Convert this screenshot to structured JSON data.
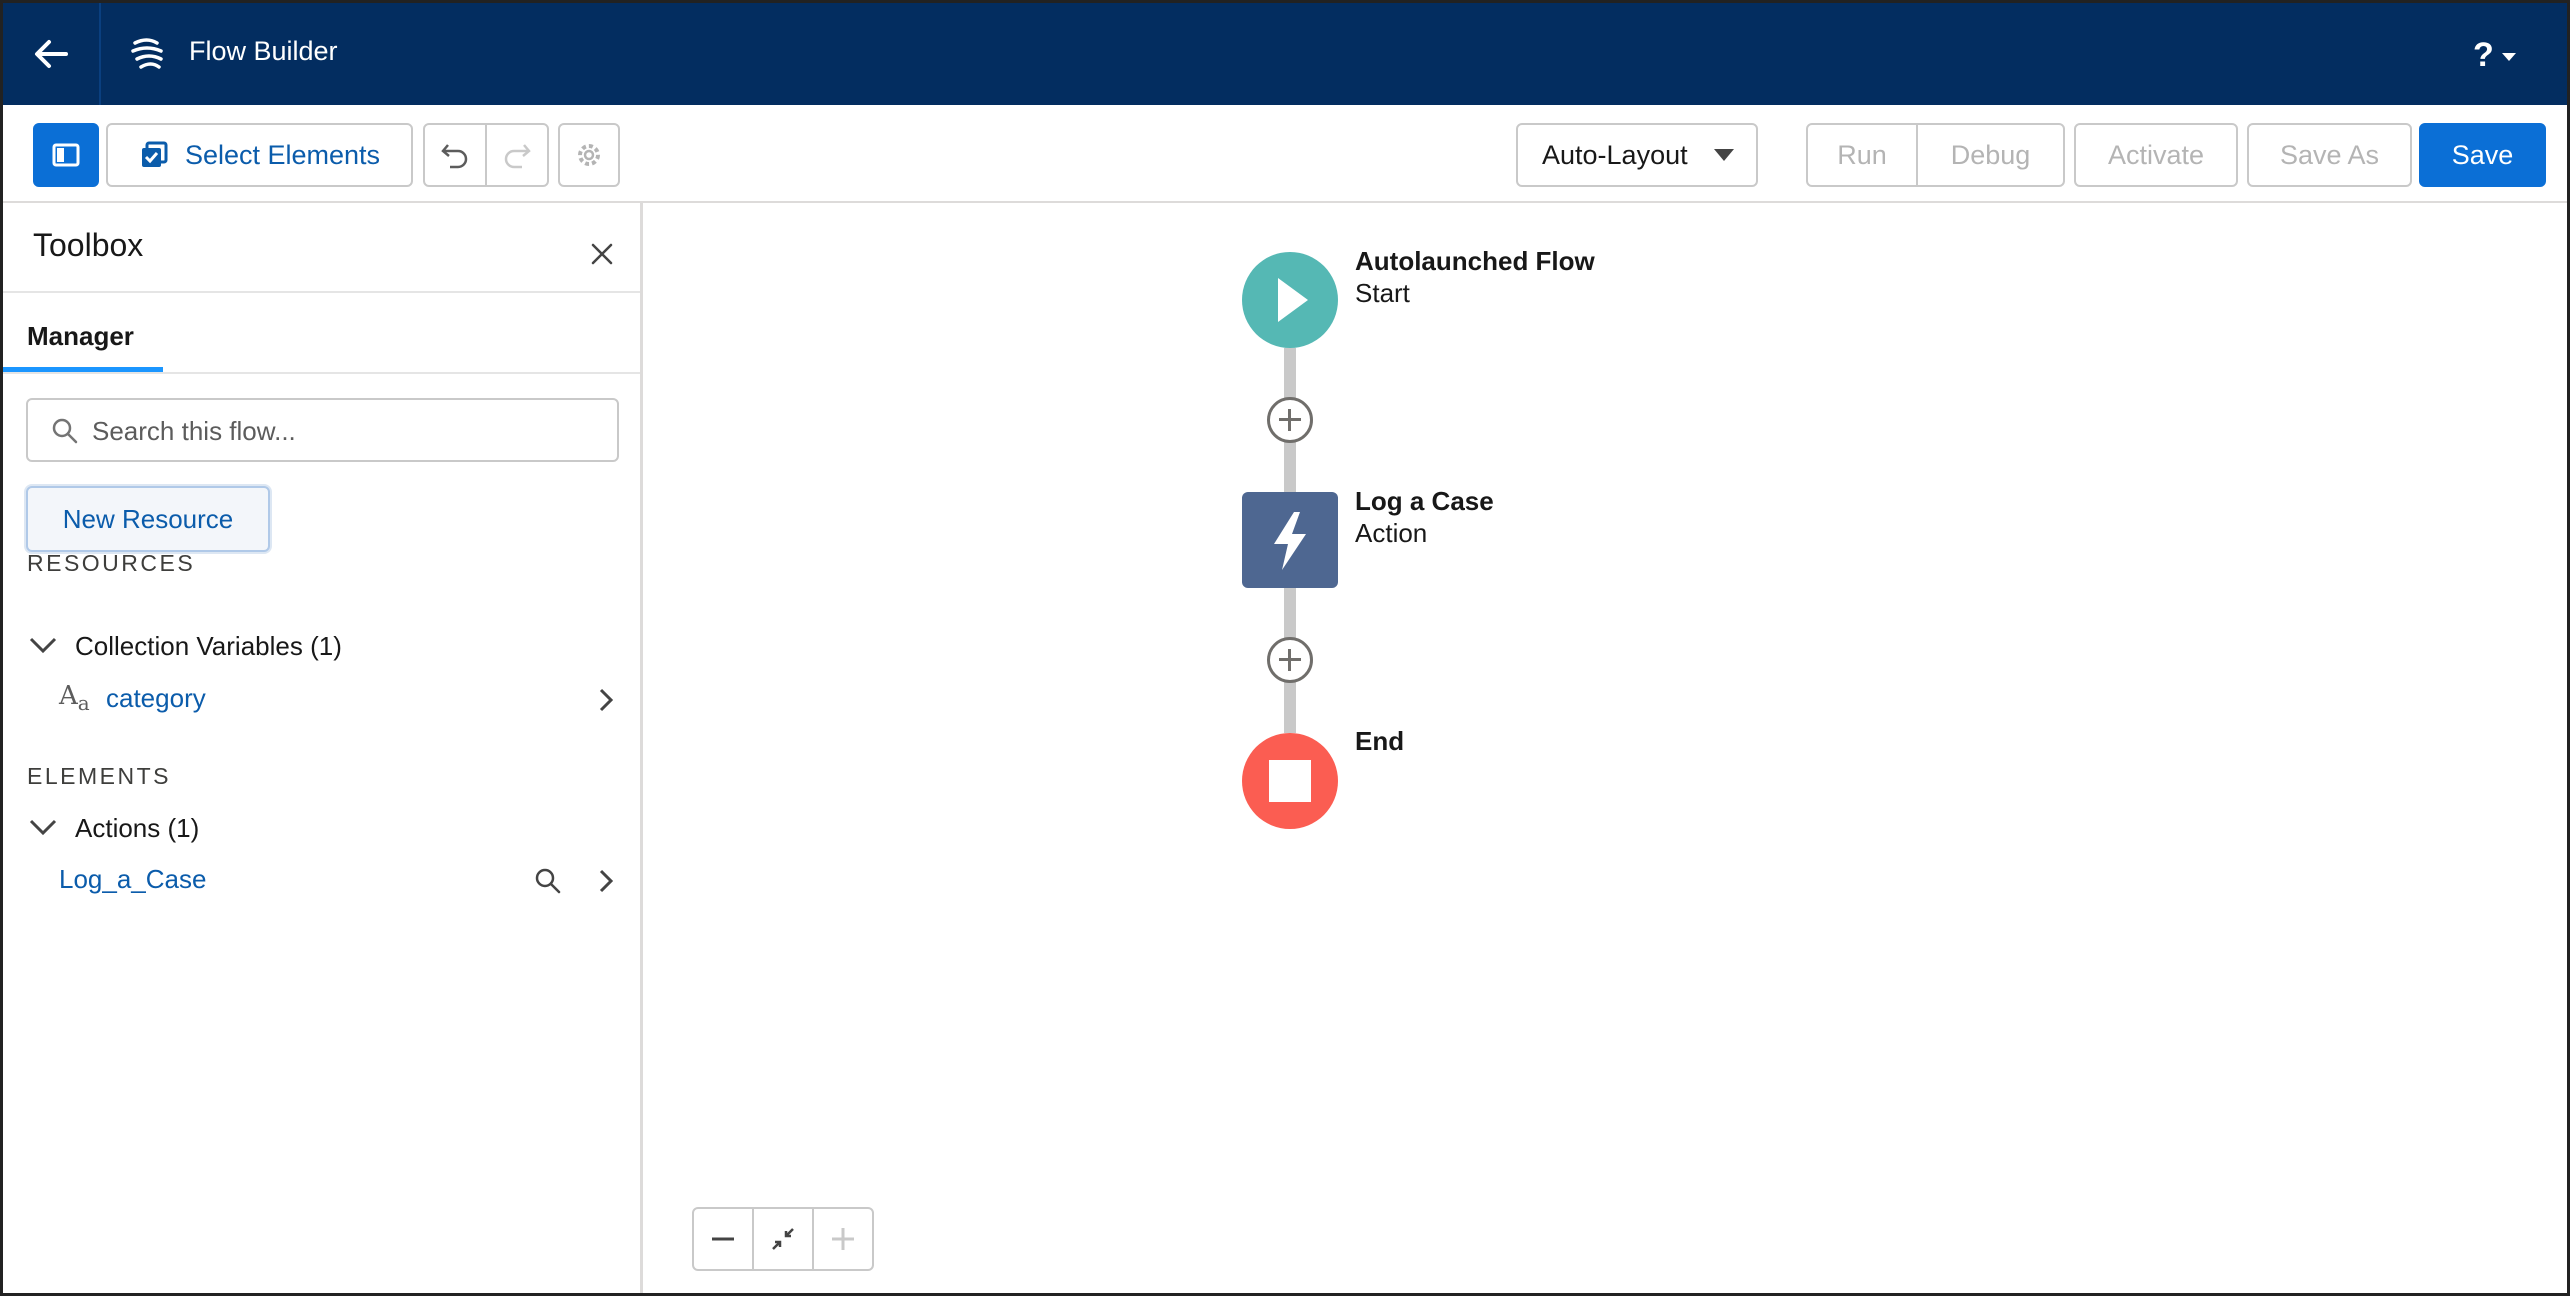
{
  "header": {
    "app_title": "Flow Builder",
    "help_label": "?",
    "back_icon": "arrow-left-icon",
    "app_icon": "flow-icon"
  },
  "toolbar": {
    "select_elements_label": "Select Elements",
    "layout_mode": "Auto-Layout",
    "run_label": "Run",
    "debug_label": "Debug",
    "activate_label": "Activate",
    "save_as_label": "Save As",
    "save_label": "Save",
    "accent_color": "#0b6fd6"
  },
  "toolbox": {
    "title": "Toolbox",
    "tabs": [
      {
        "label": "Manager",
        "active": true
      }
    ],
    "search_placeholder": "Search this flow...",
    "new_resource_label": "New Resource",
    "resources_heading": "RESOURCES",
    "resource_groups": [
      {
        "label": "Collection Variables (1)",
        "expanded": true,
        "items": [
          {
            "label": "category",
            "type_icon": "text-type-icon"
          }
        ]
      }
    ],
    "elements_heading": "ELEMENTS",
    "element_groups": [
      {
        "label": "Actions (1)",
        "expanded": true,
        "items": [
          {
            "label": "Log_a_Case"
          }
        ]
      }
    ]
  },
  "canvas": {
    "nodes": [
      {
        "title": "Autolaunched Flow",
        "subtitle": "Start",
        "type": "start",
        "color": "#55b8b4"
      },
      {
        "title": "Log a Case",
        "subtitle": "Action",
        "type": "action",
        "color": "#4e6791"
      },
      {
        "title": "End",
        "subtitle": "",
        "type": "end",
        "color": "#fb5d52"
      }
    ],
    "zoom_controls": [
      "zoom-out-icon",
      "fit-to-view-icon",
      "zoom-in-icon"
    ]
  }
}
